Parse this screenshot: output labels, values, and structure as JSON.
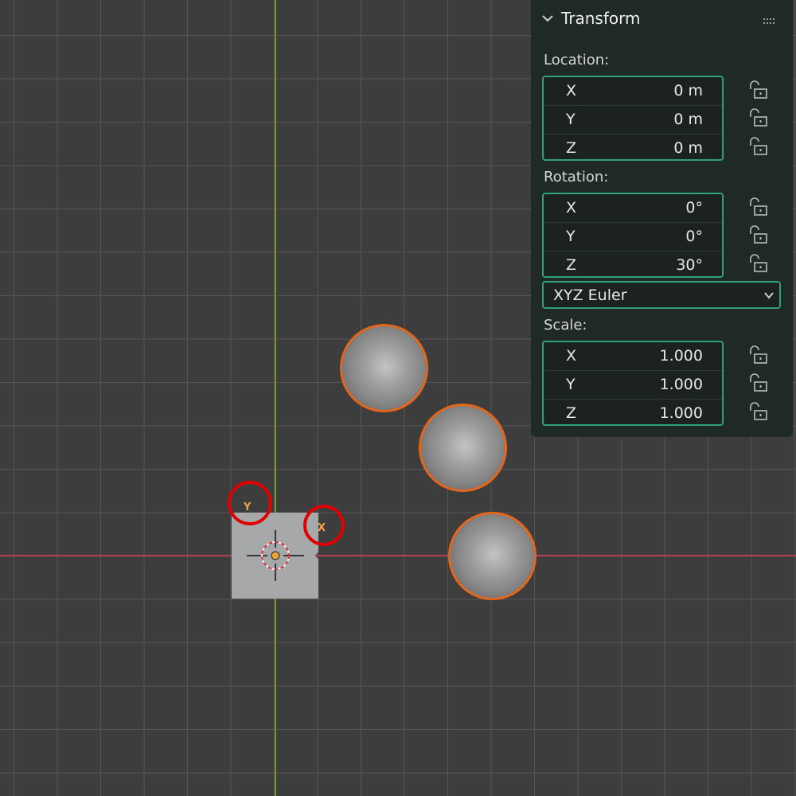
{
  "panel": {
    "title": "Transform",
    "location": {
      "label": "Location:",
      "fields": [
        {
          "axis": "X",
          "value": "0 m"
        },
        {
          "axis": "Y",
          "value": "0 m"
        },
        {
          "axis": "Z",
          "value": "0 m"
        }
      ]
    },
    "rotation": {
      "label": "Rotation:",
      "fields": [
        {
          "axis": "X",
          "value": "0°"
        },
        {
          "axis": "Y",
          "value": "0°"
        },
        {
          "axis": "Z",
          "value": "30°"
        }
      ],
      "mode": "XYZ Euler"
    },
    "scale": {
      "label": "Scale:",
      "fields": [
        {
          "axis": "X",
          "value": "1.000"
        },
        {
          "axis": "Y",
          "value": "1.000"
        },
        {
          "axis": "Z",
          "value": "1.000"
        }
      ]
    }
  },
  "viewport": {
    "gizmo_labels": {
      "y": "Y",
      "x": "X"
    },
    "colors": {
      "background": "#3d3d3d",
      "grid": "#555555",
      "y_axis": "#6f9a2a",
      "x_axis": "#b8414f",
      "selection_outline": "#e5661b",
      "annotation": "#e00000",
      "panel_accent": "#2fa07a"
    }
  }
}
